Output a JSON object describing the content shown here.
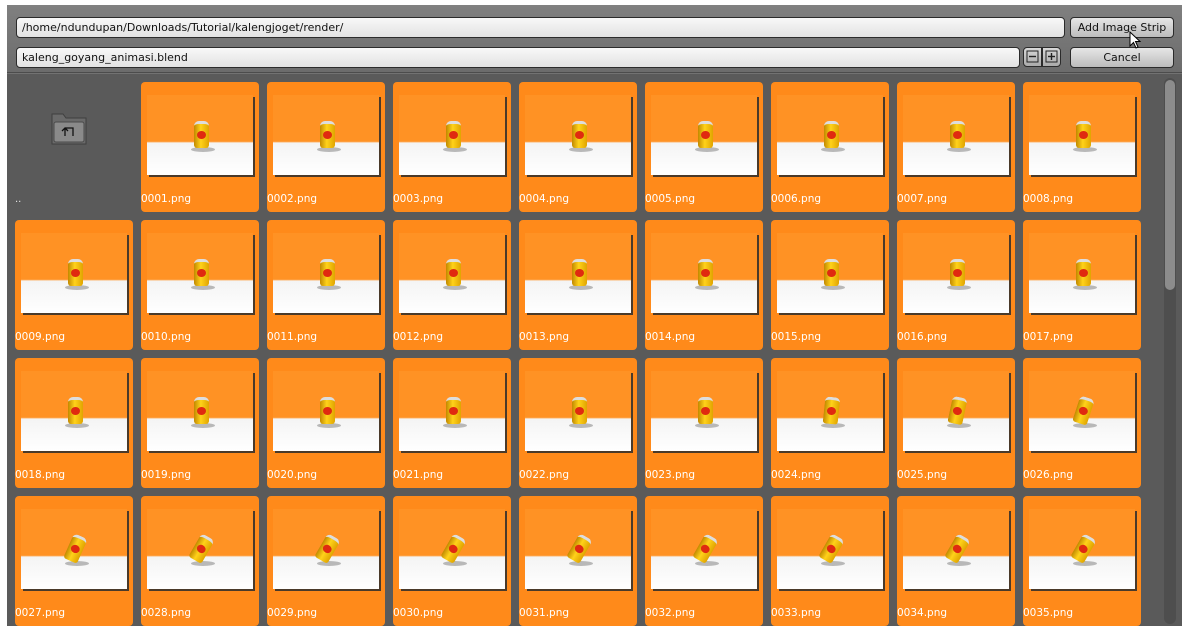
{
  "header": {
    "path_value": "/home/ndundupan/Downloads/Tutorial/kalengjoget/render/",
    "filename_value": "kaleng_goyang_animasi.blend",
    "add_button_label": "Add Image Strip",
    "cancel_button_label": "Cancel",
    "decrement_icon": "minus-icon",
    "increment_icon": "plus-icon"
  },
  "parent_dir": {
    "label": "..",
    "icon": "parent-folder-icon"
  },
  "files": [
    "0001.png",
    "0002.png",
    "0003.png",
    "0004.png",
    "0005.png",
    "0006.png",
    "0007.png",
    "0008.png",
    "0009.png",
    "0010.png",
    "0011.png",
    "0012.png",
    "0013.png",
    "0014.png",
    "0015.png",
    "0016.png",
    "0017.png",
    "0018.png",
    "0019.png",
    "0020.png",
    "0021.png",
    "0022.png",
    "0023.png",
    "0024.png",
    "0025.png",
    "0026.png",
    "0027.png",
    "0028.png",
    "0029.png",
    "0030.png",
    "0031.png",
    "0032.png",
    "0033.png",
    "0034.png",
    "0035.png"
  ],
  "colors": {
    "selected_tile": "#ff8a1a",
    "panel": "#5a5a5a",
    "header": "#727272"
  }
}
